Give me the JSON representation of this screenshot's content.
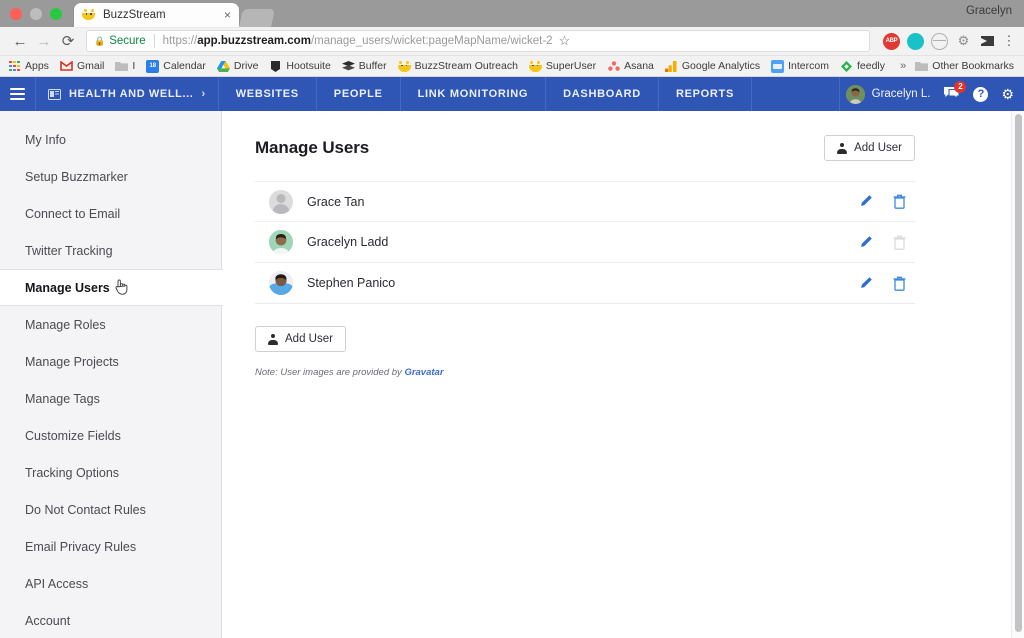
{
  "browser": {
    "os_user": "Gracelyn",
    "tab": {
      "title": "BuzzStream",
      "close_label": "×",
      "favicon": "buzzstream-bee-icon"
    },
    "nav": {
      "back_label": "←",
      "forward_label": "→",
      "reload_label": "⟳",
      "star_label": "☆",
      "kebab_label": "⋮"
    },
    "omnibox": {
      "lock_icon": "lock-icon",
      "secure_label": "Secure",
      "url_bold": "app.buzzstream.com",
      "url_scheme": "https://",
      "url_path": "/manage_users/wicket:pageMapName/wicket-2"
    },
    "extensions": [
      {
        "name": "adblock-plus-icon",
        "label": "ABP"
      },
      {
        "name": "teal-circle-extension-icon",
        "label": ""
      },
      {
        "name": "grey-circle-extension-icon",
        "label": ""
      },
      {
        "name": "gear-extension-icon",
        "label": "⚙"
      },
      {
        "name": "flag-extension-icon",
        "label": ""
      }
    ],
    "bookmarks": [
      {
        "label": "Apps",
        "icon": "apps-grid-icon"
      },
      {
        "label": "Gmail",
        "icon": "gmail-icon"
      },
      {
        "label": "I",
        "icon": "folder-icon"
      },
      {
        "label": "Calendar",
        "icon": "calendar-icon"
      },
      {
        "label": "Drive",
        "icon": "google-drive-icon"
      },
      {
        "label": "Hootsuite",
        "icon": "hootsuite-icon"
      },
      {
        "label": "Buffer",
        "icon": "buffer-icon"
      },
      {
        "label": "BuzzStream Outreach",
        "icon": "buzzstream-bee-icon"
      },
      {
        "label": "SuperUser",
        "icon": "buzzstream-bee-icon"
      },
      {
        "label": "Asana",
        "icon": "asana-icon"
      },
      {
        "label": "Google Analytics",
        "icon": "google-analytics-icon"
      },
      {
        "label": "Intercom",
        "icon": "intercom-icon"
      },
      {
        "label": "feedly",
        "icon": "feedly-icon"
      }
    ],
    "overflow_label": "»",
    "other_bookmarks": {
      "label": "Other Bookmarks",
      "icon": "folder-icon"
    }
  },
  "appnav": {
    "menu_icon": "hamburger-menu-icon",
    "project": {
      "name": "HEALTH AND WELL...",
      "icon": "project-icon",
      "chevron": "›"
    },
    "links": [
      "WEBSITES",
      "PEOPLE",
      "LINK MONITORING",
      "DASHBOARD",
      "REPORTS"
    ],
    "user": {
      "name": "Gracelyn L.",
      "avatar": "user-avatar"
    },
    "notifications": {
      "icon": "chat-bubble-icon",
      "count": "2"
    },
    "help": {
      "icon": "help-icon",
      "label": "?"
    },
    "settings": {
      "icon": "gear-icon",
      "label": "⚙"
    },
    "accent_color": "#2f56b5"
  },
  "sidebar": {
    "items": [
      {
        "label": "My Info",
        "active": false
      },
      {
        "label": "Setup Buzzmarker",
        "active": false
      },
      {
        "label": "Connect to Email",
        "active": false
      },
      {
        "label": "Twitter Tracking",
        "active": false
      },
      {
        "label": "Manage Users",
        "active": true
      },
      {
        "label": "Manage Roles",
        "active": false
      },
      {
        "label": "Manage Projects",
        "active": false
      },
      {
        "label": "Manage Tags",
        "active": false
      },
      {
        "label": "Customize Fields",
        "active": false
      },
      {
        "label": "Tracking Options",
        "active": false
      },
      {
        "label": "Do Not Contact Rules",
        "active": false
      },
      {
        "label": "Email Privacy Rules",
        "active": false
      },
      {
        "label": "API Access",
        "active": false
      },
      {
        "label": "Account",
        "active": false
      }
    ],
    "cursor": "pointing-hand-cursor"
  },
  "main": {
    "title": "Manage Users",
    "add_user_top": {
      "label": "Add User",
      "icon": "add-user-icon"
    },
    "add_user_bottom": {
      "label": "Add User",
      "icon": "add-user-icon"
    },
    "users": [
      {
        "name": "Grace Tan",
        "avatar_type": "placeholder",
        "edit_icon": "pencil-icon",
        "delete_icon": "trash-icon",
        "delete_enabled": true
      },
      {
        "name": "Gracelyn Ladd",
        "avatar_type": "photo-green",
        "edit_icon": "pencil-icon",
        "delete_icon": "trash-icon",
        "delete_enabled": false
      },
      {
        "name": "Stephen Panico",
        "avatar_type": "photo-blue",
        "edit_icon": "pencil-icon",
        "delete_icon": "trash-icon",
        "delete_enabled": true
      }
    ],
    "note_prefix": "Note: User images are provided by ",
    "note_link": "Gravatar",
    "link_color": "#3b6fd4"
  }
}
